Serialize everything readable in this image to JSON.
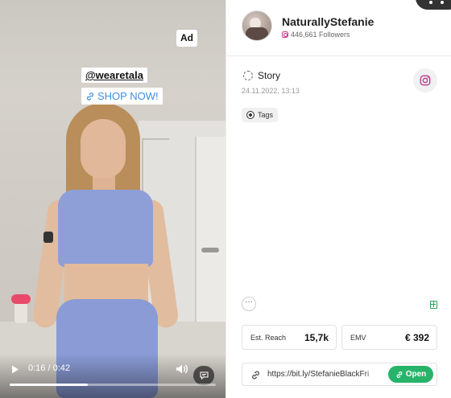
{
  "video": {
    "ad_badge": "Ad",
    "tag_handle": "@wearetala",
    "tag_cta": "SHOP NOW!",
    "time_current": "0:16",
    "time_total": "0:42",
    "time_display": "0:16 / 0:42",
    "progress": 0.38
  },
  "profile": {
    "name": "NaturallyStefanie",
    "followers": "446,661 Followers",
    "network_icon": "instagram-icon"
  },
  "post": {
    "type": "Story",
    "date": "24.11.2022, 13:13",
    "tags_label": "Tags"
  },
  "metrics": {
    "reach_label": "Est. Reach",
    "reach_value": "15,7k",
    "emv_label": "EMV",
    "emv_value": "€ 392"
  },
  "link": {
    "url": "https://bit.ly/StefanieBlackFri",
    "open_label": "Open"
  },
  "colors": {
    "open_button": "#27b46a",
    "instagram": "#c0398b",
    "sheet_icon": "#2e9f5c"
  }
}
